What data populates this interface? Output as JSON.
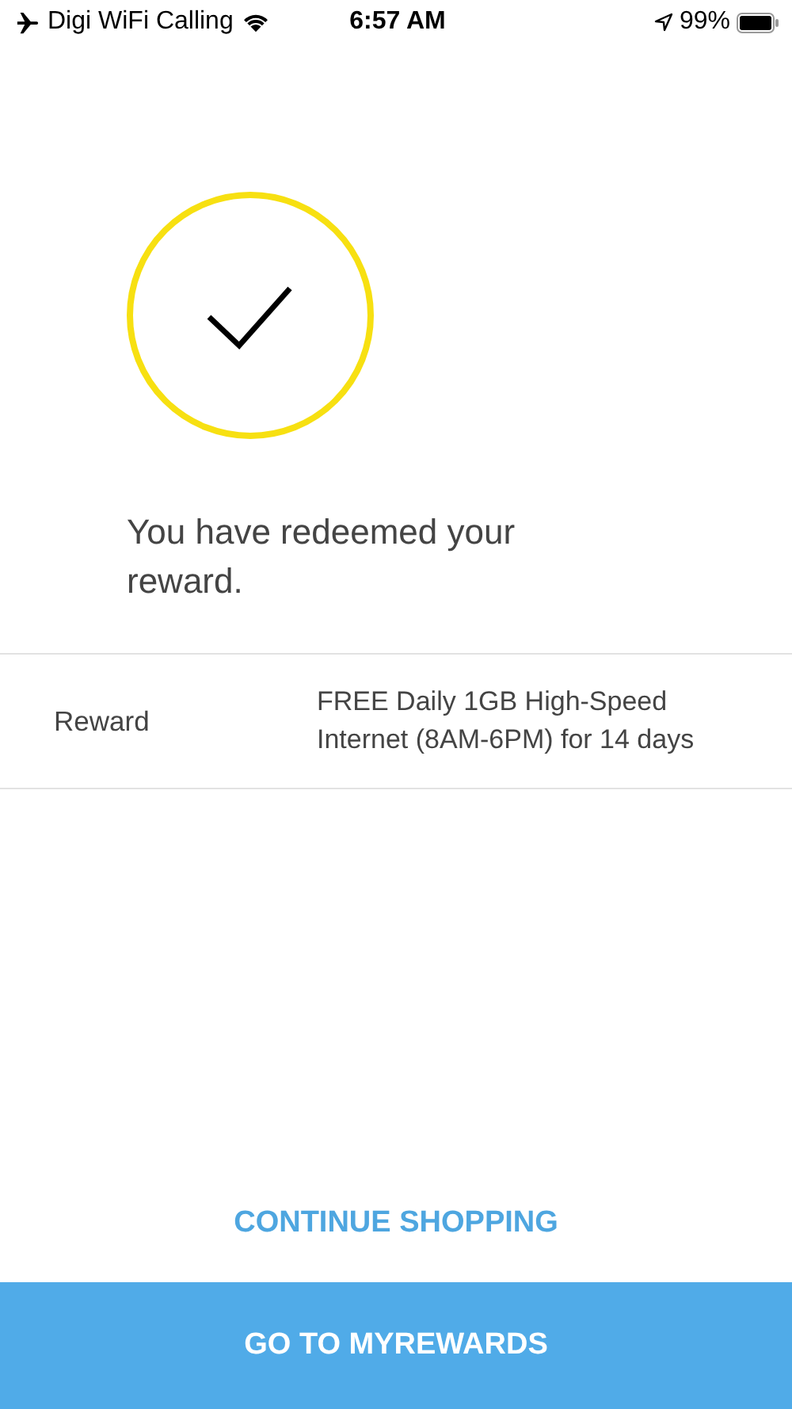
{
  "status_bar": {
    "carrier": "Digi WiFi Calling",
    "time": "6:57 AM",
    "battery": "99%"
  },
  "message": "You have redeemed your reward.",
  "details": [
    {
      "label": "Reward",
      "value": "FREE Daily 1GB High-Speed Internet (8AM-6PM) for 14 days"
    }
  ],
  "buttons": {
    "secondary": "CONTINUE SHOPPING",
    "primary": "GO TO MYREWARDS"
  }
}
